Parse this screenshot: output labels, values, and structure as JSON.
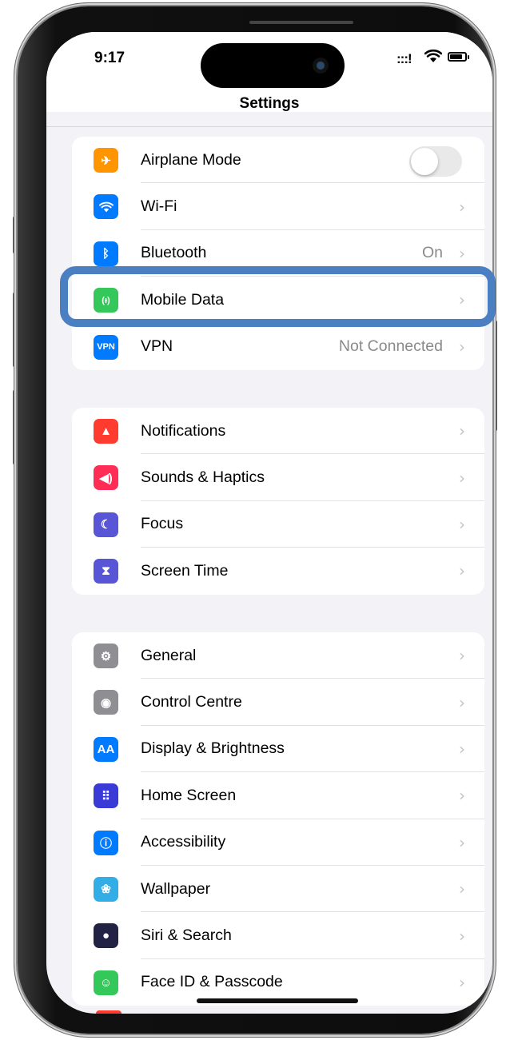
{
  "status_bar": {
    "time": "9:17",
    "signal": ":::!"
  },
  "nav": {
    "title": "Settings"
  },
  "colors": {
    "accent": "#007aff",
    "highlight": "#4a7fc1",
    "background": "#f2f2f7"
  },
  "group1": [
    {
      "label": "Airplane Mode",
      "icon": "airplane-icon",
      "glyph": "✈",
      "color": "#ff9500",
      "control": "toggle",
      "toggle_on": false
    },
    {
      "label": "Wi-Fi",
      "icon": "wifi-icon",
      "glyph": "wifi",
      "color": "#007aff"
    },
    {
      "label": "Bluetooth",
      "icon": "bluetooth-icon",
      "glyph": "ᛒ",
      "color": "#007aff",
      "value": "On"
    },
    {
      "label": "Mobile Data",
      "icon": "antenna-icon",
      "glyph": "(ᵻ)",
      "color": "#34c759"
    },
    {
      "label": "VPN",
      "icon": "vpn-icon",
      "glyph": "VPN",
      "color": "#007aff",
      "value": "Not Connected"
    }
  ],
  "group2": [
    {
      "label": "Notifications",
      "icon": "bell-icon",
      "glyph": "▲",
      "color": "#ff3b30"
    },
    {
      "label": "Sounds & Haptics",
      "icon": "speaker-icon",
      "glyph": "◀)",
      "color": "#ff2d55"
    },
    {
      "label": "Focus",
      "icon": "moon-icon",
      "glyph": "☾",
      "color": "#5856d6"
    },
    {
      "label": "Screen Time",
      "icon": "hourglass-icon",
      "glyph": "⧗",
      "color": "#5856d6"
    }
  ],
  "group3": [
    {
      "label": "General",
      "icon": "gear-icon",
      "glyph": "⚙",
      "color": "#8e8e93"
    },
    {
      "label": "Control Centre",
      "icon": "switches-icon",
      "glyph": "◉",
      "color": "#8e8e93"
    },
    {
      "label": "Display & Brightness",
      "icon": "text-size-icon",
      "glyph": "AA",
      "color": "#007aff"
    },
    {
      "label": "Home Screen",
      "icon": "app-grid-icon",
      "glyph": "⠿",
      "color": "#3a3ad6"
    },
    {
      "label": "Accessibility",
      "icon": "accessibility-icon",
      "glyph": "ⓘ",
      "color": "#007aff"
    },
    {
      "label": "Wallpaper",
      "icon": "flower-icon",
      "glyph": "❀",
      "color": "#32ade6"
    },
    {
      "label": "Siri & Search",
      "icon": "siri-icon",
      "glyph": "●",
      "color": "#222244"
    },
    {
      "label": "Face ID & Passcode",
      "icon": "face-id-icon",
      "glyph": "☺",
      "color": "#34c759"
    }
  ]
}
